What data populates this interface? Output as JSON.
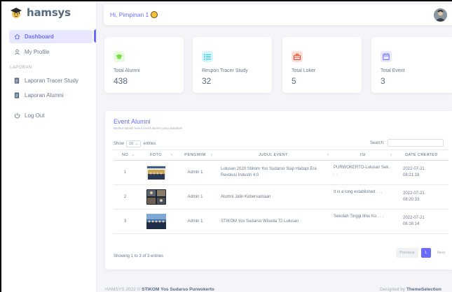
{
  "brand": {
    "name": "hamsys"
  },
  "sidebar": {
    "items": [
      {
        "label": "Dashboard",
        "icon": "home-icon"
      },
      {
        "label": "My Profile",
        "icon": "user-icon"
      }
    ],
    "section_header": "LAPORAN",
    "report_items": [
      {
        "label": "Laporan Tracer Study",
        "icon": "file-icon"
      },
      {
        "label": "Laporan Alumni",
        "icon": "file-icon"
      }
    ],
    "logout": {
      "label": "Log Out",
      "icon": "power-icon"
    }
  },
  "navbar": {
    "greeting": "Hi, Pimpinan 1"
  },
  "stats": [
    {
      "label": "Total Alumni",
      "value": "438",
      "icon": "graduation-cap-icon",
      "color": "#71dd37",
      "bg": "#e8fadf"
    },
    {
      "label": "Respon Tracer Study",
      "value": "32",
      "icon": "list-icon",
      "color": "#03c3ec",
      "bg": "#d7f5fc"
    },
    {
      "label": "Total Loker",
      "value": "5",
      "icon": "briefcase-icon",
      "color": "#ff3e1d",
      "bg": "#ffe0db"
    },
    {
      "label": "Total Event",
      "value": "3",
      "icon": "calendar-icon",
      "color": "#696cff",
      "bg": "#e7e7ff"
    }
  ],
  "events": {
    "title": "Event Alumni",
    "subtitle": "Berikut adalah event event alumni yang diadakan",
    "show_label": "Show",
    "entries_value": "10",
    "entries_label": "entries",
    "search_label": "Search:",
    "columns": [
      "NO",
      "FOTO",
      "PENGIRIM",
      "JUDUL EVENT",
      "ISI",
      "DATE CREATED"
    ],
    "rows": [
      {
        "no": "1",
        "sender": "Admin 1",
        "title": "Lulusan 2020 Stikom Yos Sudarso Siap Hadapi Era Revolusi Industri 4.0",
        "isi": "PURWOKERTO-Lulusan Sek . . .",
        "date": "2022-07-21",
        "time": "08:21:18"
      },
      {
        "no": "2",
        "sender": "Admin 1",
        "title": "Alumni Jalin Kebersamaan",
        "isi": "It is a long established . . .",
        "date": "2022-07-21",
        "time": "08:20:33"
      },
      {
        "no": "3",
        "sender": "Admin 1",
        "title": "STIKOM Yos Sudarso Wisuda 72 Lulusan",
        "isi": "Sekolah Tinggi Ilmu Ko . . .",
        "date": "2022-07-21",
        "time": "06:16:14"
      }
    ],
    "showing_text": "Showing 1 to 3 of 3 entries",
    "pager": {
      "prev": "Previous",
      "current": "1",
      "next": "Next"
    }
  },
  "footer": {
    "left_prefix": "HAMSYS 2022 ©",
    "left_brand": "STIKOM Yos Sudarso Purwokerto",
    "right_prefix": "Designed by",
    "right_brand": "ThemeSelection"
  }
}
